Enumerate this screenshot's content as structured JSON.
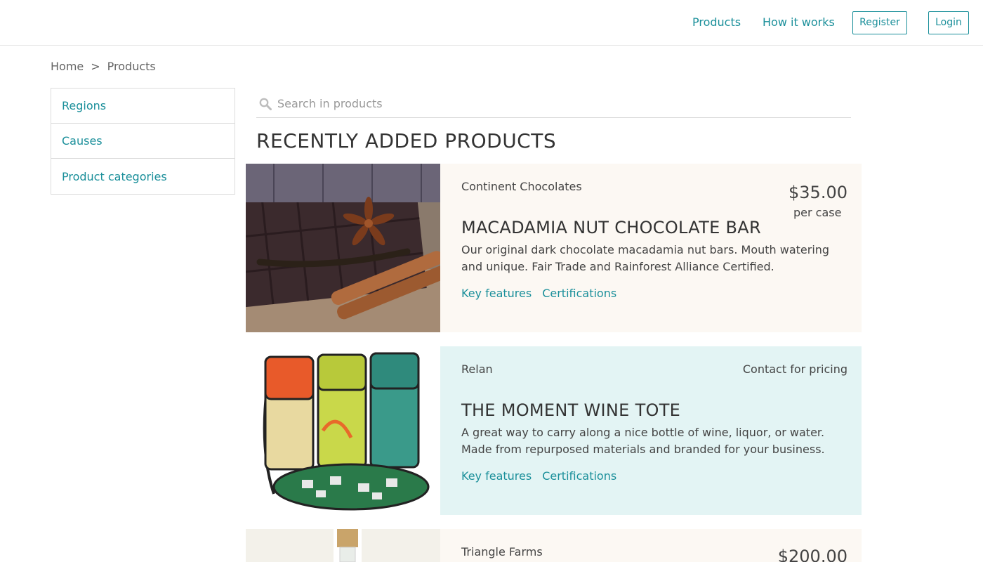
{
  "header": {
    "nav": [
      "Products",
      "How it works"
    ],
    "register_label": "Register",
    "login_label": "Login"
  },
  "breadcrumb": {
    "home": "Home",
    "separator": ">",
    "current": "Products"
  },
  "sidebar": {
    "items": [
      {
        "label": "Regions"
      },
      {
        "label": "Causes"
      },
      {
        "label": "Product categories"
      }
    ]
  },
  "search": {
    "placeholder": "Search in products",
    "icon": "search-icon"
  },
  "section_title": "RECENTLY ADDED PRODUCTS",
  "products": [
    {
      "supplier": "Continent Chocolates",
      "price": "$35.00",
      "price_unit": "per case",
      "title": "MACADAMIA NUT CHOCOLATE BAR",
      "description": "Our original dark chocolate macadamia nut bars. Mouth watering and unique. Fair Trade and Rainforest Alliance Certified.",
      "links": [
        "Key features",
        "Certifications"
      ],
      "background": "#fcf8f3"
    },
    {
      "supplier": "Relan",
      "contact": "Contact for pricing",
      "title": "THE MOMENT WINE TOTE",
      "description": "A great way to carry along a nice bottle of wine, liquor, or water. Made from repurposed materials and branded for your business.",
      "links": [
        "Key features",
        "Certifications"
      ],
      "background": "#e3f4f4"
    },
    {
      "supplier": "Triangle Farms",
      "price": "$200.00"
    }
  ],
  "colors": {
    "accent": "#1a8f9a",
    "text": "#333333",
    "border": "#dcdcdc"
  }
}
